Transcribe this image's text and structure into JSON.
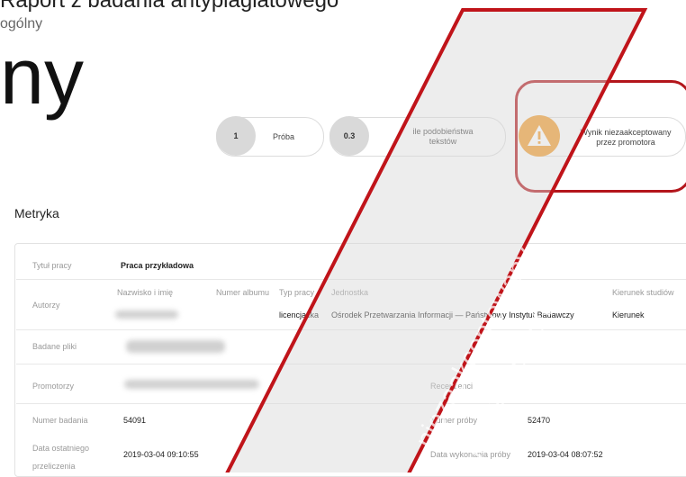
{
  "header": {
    "report_title": "Raport z badania antyplagiatowego",
    "report_subtitle": "ogólny",
    "large_fragment": "ny"
  },
  "summary": {
    "attempt": {
      "value": "1",
      "label": "Próba"
    },
    "similarity": {
      "value": "0.3",
      "label_line1": "ile podobieństwa",
      "label_line2": "tekstów"
    },
    "result": {
      "icon": "warning-icon",
      "label_line1": "Wynik niezaakceptowany",
      "label_line2": "przez promotora"
    }
  },
  "section_title": "Metryka",
  "metrics": {
    "title_label": "Tytuł pracy",
    "title_value": "Praca przykładowa",
    "authors_label": "Autorzy",
    "authors_columns": {
      "name": "Nazwisko i imię",
      "album": "Numer albumu",
      "type": "Typ pracy",
      "unit": "Jednostka",
      "field": "Kierunek studiów"
    },
    "authors_row": {
      "type": "licencjacka",
      "unit": "Ośrodek Przetwarzania Informacji — Państwowy Instytut Badawczy",
      "field": "Kierunek"
    },
    "files_label": "Badane pliki",
    "promoters_label": "Promotorzy",
    "reviewers_label": "Recenzenci",
    "exam_number_label": "Numer badania",
    "exam_number_value": "54091",
    "attempt_number_label": "Numer próby",
    "attempt_number_value": "52470",
    "last_calc_label_1": "Data ostatniego",
    "last_calc_label_2": "przeliczenia",
    "last_calc_value": "2019-03-04 09:10:55",
    "attempt_date_label": "Data wykonania próby",
    "attempt_date_value": "2019-03-04 08:07:52"
  },
  "overlay": {
    "watermark_line1": "niezaakceptowany",
    "watermark_line2": "przez promotora",
    "accent_color": "#b3151b"
  }
}
